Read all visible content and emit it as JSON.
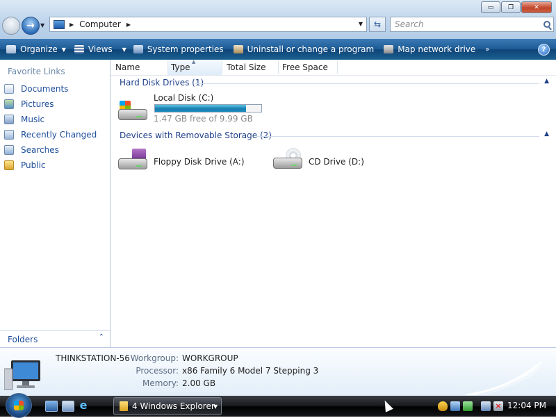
{
  "window": {
    "minimize_label": "▭",
    "maximize_label": "❐",
    "close_label": "✕"
  },
  "address_bar": {
    "location": "Computer",
    "search_placeholder": "Search"
  },
  "command_bar": {
    "organize": "Organize",
    "views": "Views",
    "system_properties": "System properties",
    "uninstall": "Uninstall or change a program",
    "map_network_drive": "Map network drive",
    "more": "»",
    "help": "?"
  },
  "nav_pane": {
    "favorite_links_title": "Favorite Links",
    "items": [
      {
        "label": "Documents",
        "icon": "documents-icon"
      },
      {
        "label": "Pictures",
        "icon": "pictures-icon"
      },
      {
        "label": "Music",
        "icon": "music-icon"
      },
      {
        "label": "Recently Changed",
        "icon": "recently-changed-icon"
      },
      {
        "label": "Searches",
        "icon": "searches-icon"
      },
      {
        "label": "Public",
        "icon": "public-folder-icon"
      }
    ],
    "folders_label": "Folders",
    "folders_chevron": "⌃"
  },
  "columns": [
    "Name",
    "Type",
    "Total Size",
    "Free Space"
  ],
  "groups": {
    "hard_disks": {
      "title": "Hard Disk Drives (1)",
      "drives": [
        {
          "name": "Local Disk (C:)",
          "free_text": "1.47 GB free of 9.99 GB",
          "used_fraction": 0.853
        }
      ]
    },
    "removable": {
      "title": "Devices with Removable Storage (2)",
      "drives": [
        {
          "name": "Floppy Disk Drive (A:)"
        },
        {
          "name": "CD Drive (D:)"
        }
      ]
    }
  },
  "details": {
    "computer_name": "THINKSTATION-56",
    "workgroup_label": "Workgroup:",
    "workgroup_value": "WORKGROUP",
    "processor_label": "Processor:",
    "processor_value": "x86 Family 6 Model 7 Stepping 3",
    "memory_label": "Memory:",
    "memory_value": "2.00 GB"
  },
  "taskbar": {
    "task_label": "4 Windows Explorer",
    "clock": "12:04 PM"
  },
  "colors": {
    "link_blue": "#1e4e9b",
    "group_blue": "#1e3f8a",
    "command_bar": "#1d5c94",
    "usage_fill": "#1a7fb0"
  }
}
